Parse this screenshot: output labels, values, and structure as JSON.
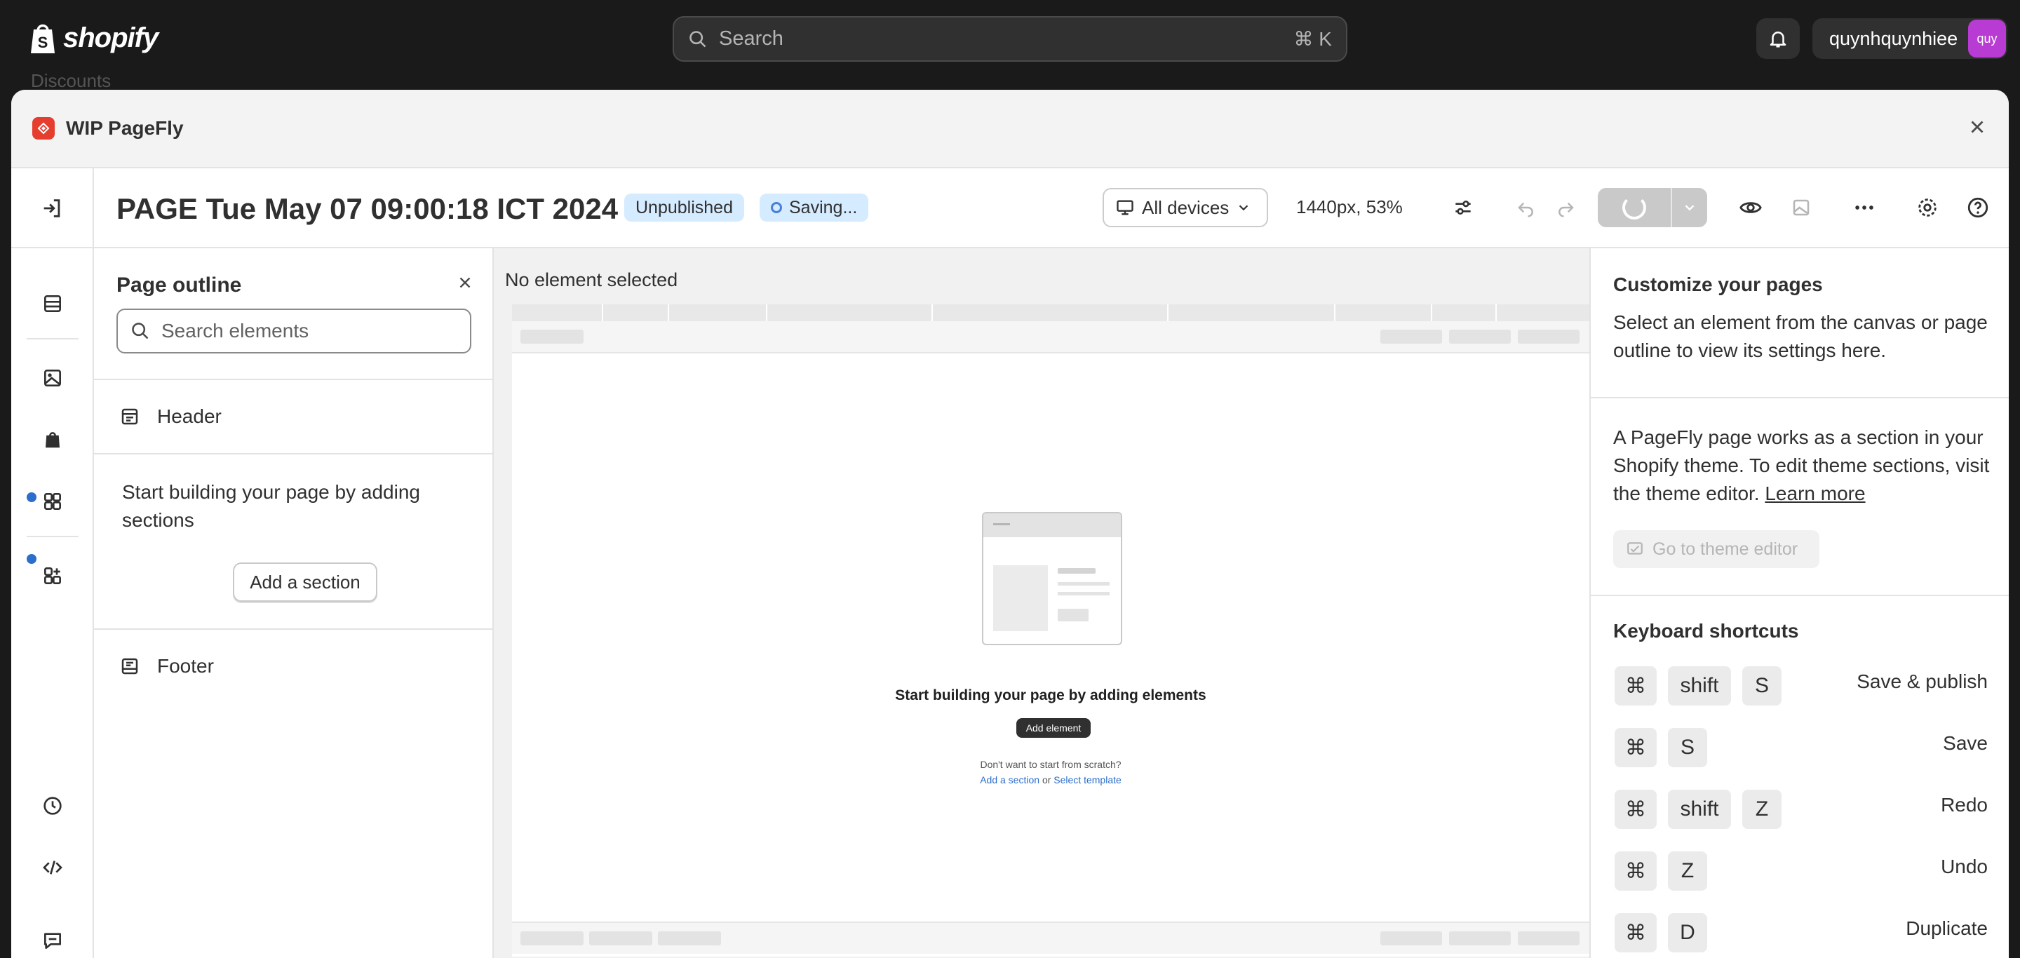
{
  "topbar": {
    "brand": "shopify",
    "search_placeholder": "Search",
    "search_shortcut": "⌘ K",
    "username": "quynhquynhiee",
    "avatar_text": "quy"
  },
  "behind_nav_item": "Discounts",
  "modal": {
    "app_title": "WIP PageFly"
  },
  "toolbar": {
    "page_title": "PAGE Tue May 07 09:00:18 ICT 2024",
    "status_badge": "Unpublished",
    "saving_badge": "Saving...",
    "device_select": "All devices",
    "viewport": "1440px, 53%"
  },
  "outline": {
    "title": "Page outline",
    "search_placeholder": "Search elements",
    "header_label": "Header",
    "empty_text": "Start building your page by adding sections",
    "add_section_label": "Add a section",
    "footer_label": "Footer"
  },
  "canvas": {
    "no_selection": "No element selected",
    "empty_title": "Start building your page by adding elements",
    "add_element": "Add element",
    "scratch_text": "Don't want to start from scratch?",
    "add_section_link": "Add a section",
    "or_text": "or",
    "select_template_link": "Select template"
  },
  "right_panel": {
    "customize_title": "Customize your pages",
    "customize_text": "Select an element from the canvas or page outline to view its settings here.",
    "section_text": "A PageFly page works as a section in your Shopify theme. To edit theme sections, visit the theme editor.",
    "learn_more": "Learn more",
    "theme_editor_btn": "Go to theme editor",
    "shortcuts_title": "Keyboard shortcuts",
    "shortcuts": [
      {
        "keys": [
          "⌘",
          "shift",
          "S"
        ],
        "label": "Save & publish"
      },
      {
        "keys": [
          "⌘",
          "S"
        ],
        "label": "Save"
      },
      {
        "keys": [
          "⌘",
          "shift",
          "Z"
        ],
        "label": "Redo"
      },
      {
        "keys": [
          "⌘",
          "Z"
        ],
        "label": "Undo"
      },
      {
        "keys": [
          "⌘",
          "D"
        ],
        "label": "Duplicate"
      }
    ]
  },
  "colors": {
    "topbar_bg": "#1a1a1a",
    "badge_bg": "#d5ebff",
    "link": "#2c6ecb",
    "status_dot": "#2c6ecb",
    "avatar_bg": "#b83bd4",
    "pagefly_red": "#e53e2e"
  },
  "icons": {
    "brand": "shopify-bag-icon",
    "search": "search-icon",
    "notifications": "bell-icon",
    "close": "close-icon",
    "exit": "exit-icon",
    "devices": "desktop-icon",
    "settings": "sliders-icon",
    "undo": "undo-icon",
    "redo": "redo-icon",
    "preview": "eye-icon",
    "more": "more-horizontal-icon",
    "page_settings": "gear-icon",
    "help": "help-icon"
  }
}
